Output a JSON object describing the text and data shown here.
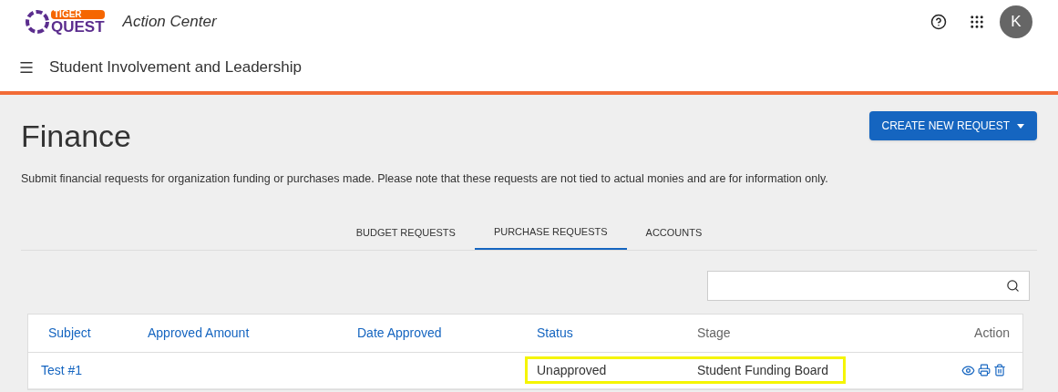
{
  "header": {
    "logo_top": "TIGER",
    "logo_bottom": "QUEST",
    "title": "Action Center",
    "avatar": "K"
  },
  "subheader": {
    "title": "Student Involvement and Leadership"
  },
  "page": {
    "title": "Finance",
    "create_button": "CREATE NEW REQUEST",
    "description": "Submit financial requests for organization funding or purchases made. Please note that these requests are not tied to actual monies and are for information only."
  },
  "tabs": [
    {
      "label": "BUDGET REQUESTS",
      "selected": false
    },
    {
      "label": "PURCHASE REQUESTS",
      "selected": true
    },
    {
      "label": "ACCOUNTS",
      "selected": false
    }
  ],
  "table": {
    "columns": [
      {
        "label": "Subject",
        "sortable": true
      },
      {
        "label": "Approved Amount",
        "sortable": true
      },
      {
        "label": "Date Approved",
        "sortable": true
      },
      {
        "label": "Status",
        "sortable": true
      },
      {
        "label": "Stage",
        "sortable": false
      },
      {
        "label": "Action",
        "sortable": false
      }
    ],
    "rows": [
      {
        "cells": [
          {
            "text": "Test #1",
            "highlighted": false,
            "kind": "link"
          },
          {
            "highlighted": false,
            "kind": "text"
          },
          {
            "highlighted": false,
            "kind": "text"
          },
          {
            "text": "Unapproved",
            "highlighted": true,
            "kind": "text"
          },
          {
            "text": "Student Funding Board",
            "highlighted": true,
            "kind": "text"
          },
          {
            "highlighted": false,
            "kind": "actions"
          }
        ]
      }
    ]
  }
}
